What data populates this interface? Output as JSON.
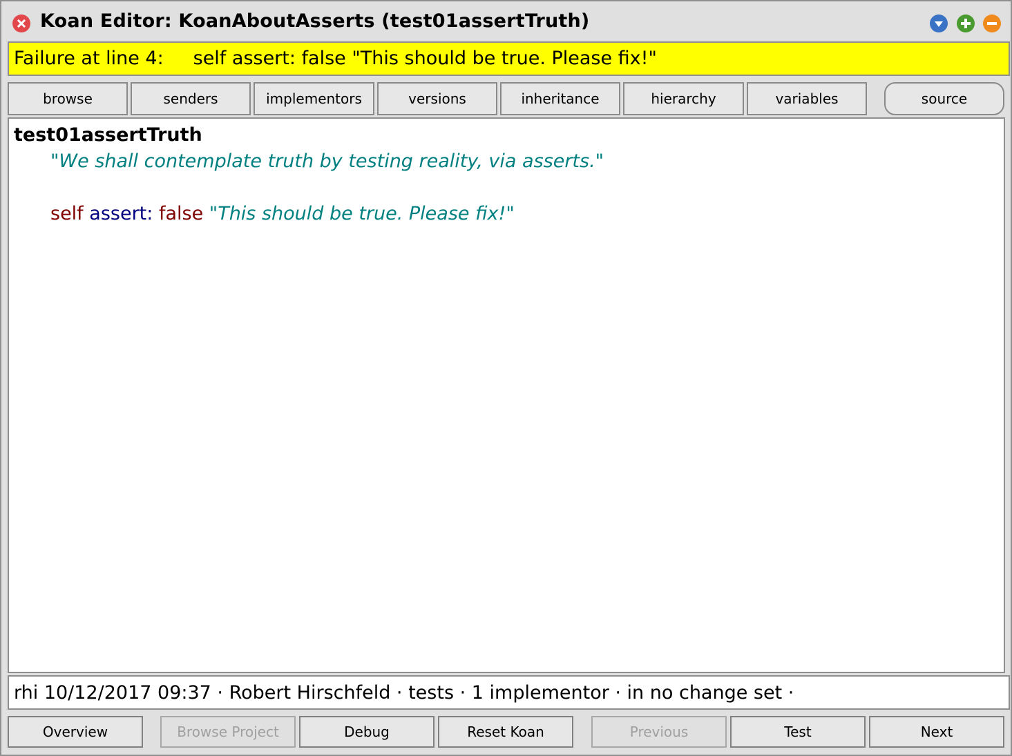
{
  "window": {
    "title": "Koan Editor: KoanAboutAsserts (test01assertTruth)",
    "icons": {
      "close": "close-icon",
      "menu": "chevron-down-icon",
      "expand": "plus-icon",
      "collapse": "minus-icon"
    }
  },
  "failure": {
    "text": "Failure at line 4:     self assert: false \"This should be true. Please fix!\"",
    "background": "#ffff00"
  },
  "toolbar": {
    "buttons": [
      {
        "label": "browse"
      },
      {
        "label": "senders"
      },
      {
        "label": "implementors"
      },
      {
        "label": "versions"
      },
      {
        "label": "inheritance"
      },
      {
        "label": "hierarchy"
      },
      {
        "label": "variables"
      },
      {
        "label": "source"
      }
    ]
  },
  "code": {
    "method_name": "test01assertTruth",
    "comment_open_quote": "\"",
    "comment_text": "We shall contemplate truth by testing reality, via asserts.",
    "comment_close_quote": "\"",
    "stmt_receiver": "self",
    "stmt_keyword": "assert:",
    "stmt_arg": "false",
    "stmt_str_open": "\"",
    "stmt_str_text": "This should be true. Please fix!",
    "stmt_str_close": "\"",
    "colors": {
      "comment": "#008080",
      "receiver": "#800000",
      "keyword": "#000080",
      "literal": "#800000",
      "string": "#008080"
    }
  },
  "status": {
    "text": "rhi 10/12/2017 09:37 · Robert Hirschfeld · tests · 1 implementor · in no change set ·"
  },
  "bottom": {
    "buttons": [
      {
        "label": "Overview",
        "enabled": true
      },
      {
        "label": "Browse Project",
        "enabled": false
      },
      {
        "label": "Debug",
        "enabled": true
      },
      {
        "label": "Reset Koan",
        "enabled": true
      },
      {
        "label": "Previous",
        "enabled": false
      },
      {
        "label": "Test",
        "enabled": true
      },
      {
        "label": "Next",
        "enabled": true
      }
    ]
  }
}
